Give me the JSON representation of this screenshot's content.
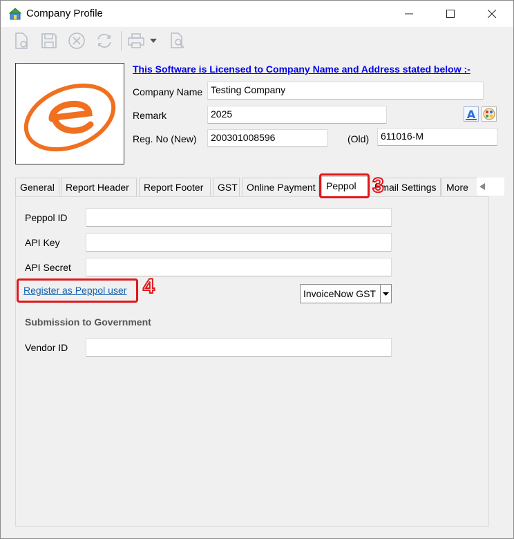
{
  "window": {
    "title": "Company Profile"
  },
  "header": {
    "license_text": "This Software is Licensed to Company Name and Address stated below :-",
    "company_name_label": "Company Name",
    "company_name_value": "Testing Company",
    "remark_label": "Remark",
    "remark_value": "2025",
    "reg_new_label": "Reg. No (New)",
    "reg_new_value": "200301008596",
    "reg_old_label": "(Old)",
    "reg_old_value": "611016-M"
  },
  "tabs": [
    {
      "label": "General"
    },
    {
      "label": "Report Header"
    },
    {
      "label": "Report Footer"
    },
    {
      "label": "GST"
    },
    {
      "label": "Online Payment"
    },
    {
      "label": "Peppol"
    },
    {
      "label": "Email Settings"
    },
    {
      "label": "More"
    }
  ],
  "peppol": {
    "peppol_id_label": "Peppol ID",
    "peppol_id_value": "",
    "api_key_label": "API Key",
    "api_key_value": "",
    "api_secret_label": "API Secret",
    "api_secret_value": "",
    "register_link": "Register as Peppol user",
    "invoice_option": "InvoiceNow GST",
    "section_title": "Submission to Government",
    "vendor_id_label": "Vendor ID",
    "vendor_id_value": ""
  },
  "annotations": {
    "step3": "3",
    "step4": "4"
  },
  "colors": {
    "highlight": "#e0161b",
    "link": "#1060b0",
    "license": "#0000ee",
    "logo": "#f07020"
  }
}
